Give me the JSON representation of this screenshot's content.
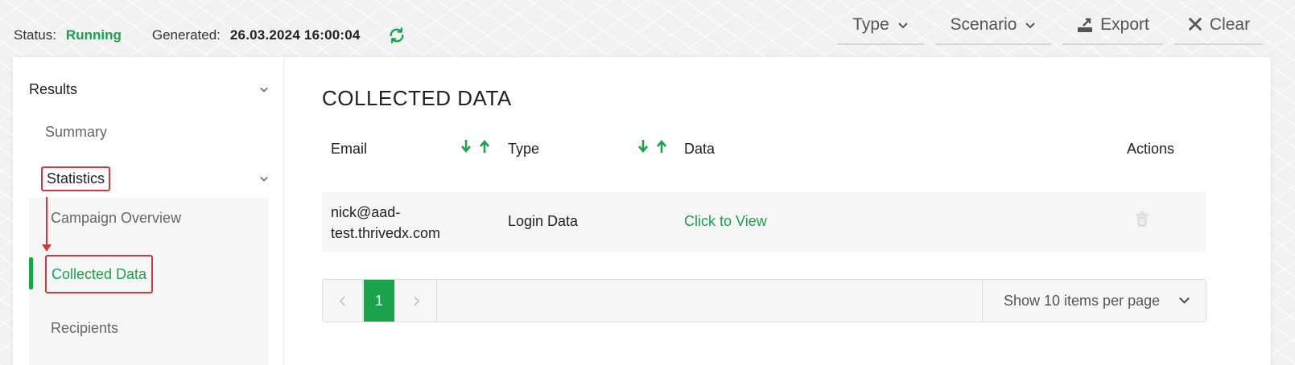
{
  "status": {
    "label": "Status:",
    "value": "Running",
    "generated_label": "Generated:",
    "generated_value": "26.03.2024 16:00:04",
    "refresh_icon": "refresh-icon"
  },
  "toolbar": {
    "type_label": "Type",
    "scenario_label": "Scenario",
    "export_label": "Export",
    "clear_label": "Clear"
  },
  "sidebar": {
    "results": "Results",
    "summary": "Summary",
    "statistics": "Statistics",
    "campaign_overview": "Campaign Overview",
    "collected_data": "Collected Data",
    "recipients": "Recipients"
  },
  "main": {
    "title": "COLLECTED DATA",
    "columns": [
      "Email",
      "Type",
      "Data",
      "Actions"
    ],
    "rows": [
      {
        "email_line1": "nick@aad-",
        "email_line2": "test.thrivedx.com",
        "type": "Login Data",
        "data": "Click to View"
      }
    ],
    "pagination": {
      "current_page": "1",
      "page_size_label": "Show 10 items per page"
    }
  },
  "colors": {
    "accent": "#1aa34a",
    "highlight": "#cc3b3b"
  }
}
